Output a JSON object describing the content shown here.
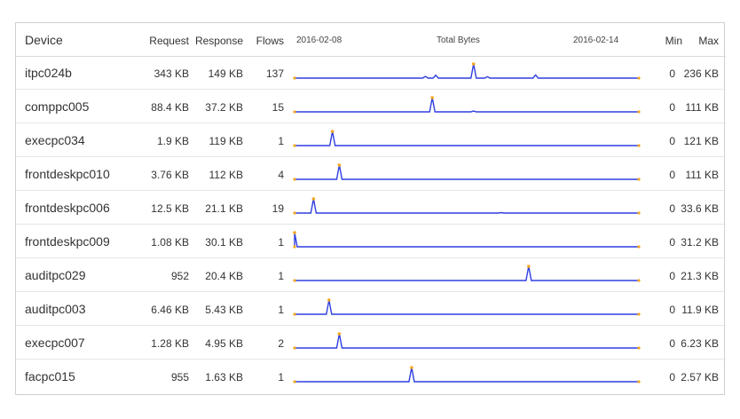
{
  "table": {
    "headers": {
      "device": "Device",
      "request": "Request",
      "response": "Response",
      "flows": "Flows",
      "start_date": "2016-02-08",
      "total_bytes": "Total Bytes",
      "end_date": "2016-02-14",
      "min": "Min",
      "max": "Max"
    },
    "rows": [
      {
        "device": "itpc024b",
        "request": "343 KB",
        "response": "149 KB",
        "flows": "137",
        "min": "0",
        "max": "236 KB",
        "spark": {
          "max_kb": 236,
          "peaks": [
            [
              0.38,
              0.12
            ],
            [
              0.41,
              0.2
            ],
            [
              0.52,
              1.0
            ],
            [
              0.56,
              0.1
            ],
            [
              0.7,
              0.22
            ]
          ]
        }
      },
      {
        "device": "comppc005",
        "request": "88.4 KB",
        "response": "37.2 KB",
        "flows": "15",
        "min": "0",
        "max": "111 KB",
        "spark": {
          "max_kb": 111,
          "peaks": [
            [
              0.4,
              1.0
            ],
            [
              0.52,
              0.06
            ]
          ]
        }
      },
      {
        "device": "execpc034",
        "request": "1.9 KB",
        "response": "119 KB",
        "flows": "1",
        "min": "0",
        "max": "121 KB",
        "spark": {
          "max_kb": 121,
          "peaks": [
            [
              0.11,
              1.0
            ]
          ]
        }
      },
      {
        "device": "frontdeskpc010",
        "request": "3.76 KB",
        "response": "112 KB",
        "flows": "4",
        "min": "0",
        "max": "111 KB",
        "spark": {
          "max_kb": 111,
          "peaks": [
            [
              0.13,
              1.0
            ]
          ]
        }
      },
      {
        "device": "frontdeskpc006",
        "request": "12.5 KB",
        "response": "21.1 KB",
        "flows": "19",
        "min": "0",
        "max": "33.6 KB",
        "spark": {
          "max_kb": 33.6,
          "peaks": [
            [
              0.055,
              1.0
            ],
            [
              0.6,
              0.03
            ]
          ]
        }
      },
      {
        "device": "frontdeskpc009",
        "request": "1.08 KB",
        "response": "30.1 KB",
        "flows": "1",
        "min": "0",
        "max": "31.2 KB",
        "spark": {
          "max_kb": 31.2,
          "peaks": [
            [
              0.0,
              1.0
            ]
          ]
        }
      },
      {
        "device": "auditpc029",
        "request": "952",
        "response": "20.4 KB",
        "flows": "1",
        "min": "0",
        "max": "21.3 KB",
        "spark": {
          "max_kb": 21.3,
          "peaks": [
            [
              0.68,
              1.0
            ]
          ]
        }
      },
      {
        "device": "auditpc003",
        "request": "6.46 KB",
        "response": "5.43 KB",
        "flows": "1",
        "min": "0",
        "max": "11.9 KB",
        "spark": {
          "max_kb": 11.9,
          "peaks": [
            [
              0.1,
              1.0
            ]
          ]
        }
      },
      {
        "device": "execpc007",
        "request": "1.28 KB",
        "response": "4.95 KB",
        "flows": "2",
        "min": "0",
        "max": "6.23 KB",
        "spark": {
          "max_kb": 6.23,
          "peaks": [
            [
              0.13,
              1.0
            ]
          ]
        }
      },
      {
        "device": "facpc015",
        "request": "955",
        "response": "1.63 KB",
        "flows": "1",
        "min": "0",
        "max": "2.57 KB",
        "spark": {
          "max_kb": 2.57,
          "peaks": [
            [
              0.34,
              1.0
            ]
          ]
        }
      }
    ]
  },
  "colors": {
    "line": "#2f3fe0",
    "line_light": "#b8c6f7",
    "peak_marker": "#f5a623",
    "end_marker": "#f5a623"
  }
}
